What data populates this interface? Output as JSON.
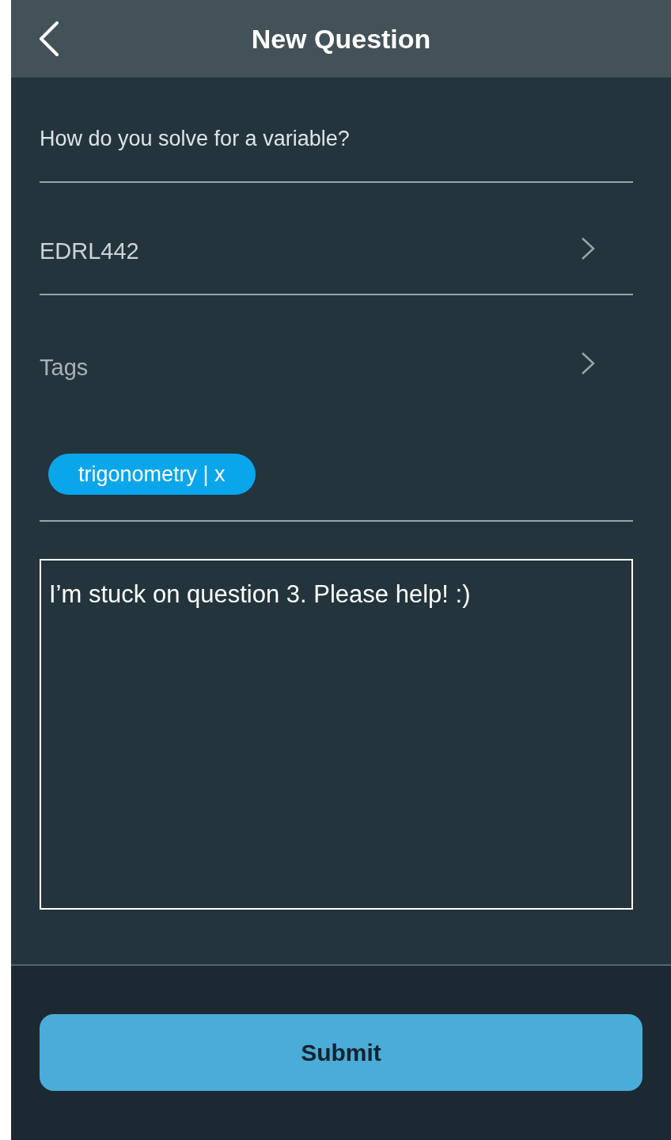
{
  "header": {
    "title": "New Question"
  },
  "question": {
    "value": "How do you solve for a variable?"
  },
  "course": {
    "value": "EDRL442"
  },
  "tags": {
    "placeholder": "Tags",
    "chips": [
      {
        "label": "trigonometry | x"
      }
    ]
  },
  "body": {
    "value": "I’m stuck on question 3. Please help! :)"
  },
  "submit": {
    "label": "Submit"
  }
}
